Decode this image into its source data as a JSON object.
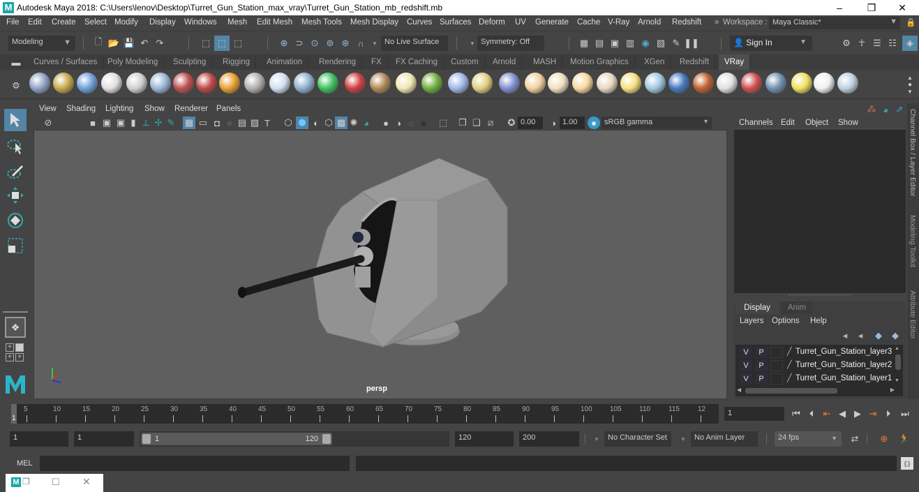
{
  "window": {
    "title": "Autodesk Maya 2018: C:\\Users\\lenov\\Desktop\\Turret_Gun_Station_max_vray\\Turret_Gun_Station_mb_redshift.mb",
    "minimize": "–",
    "restore": "❐",
    "close": "✕"
  },
  "menubar": {
    "items": [
      "File",
      "Edit",
      "Create",
      "Select",
      "Modify",
      "Display",
      "Windows",
      "Mesh",
      "Edit Mesh",
      "Mesh Tools",
      "Mesh Display",
      "Curves",
      "Surfaces",
      "Deform",
      "UV",
      "Generate",
      "Cache",
      "V-Ray",
      "Arnold",
      "Redshift"
    ],
    "workspace_label": "Workspace :",
    "workspace_value": "Maya Classic*"
  },
  "statusline": {
    "mode": "Modeling",
    "live_surface": "No Live Surface",
    "symmetry": "Symmetry: Off",
    "sign_in": "Sign In"
  },
  "shelf": {
    "tabs": [
      "Curves / Surfaces",
      "Poly Modeling",
      "Sculpting",
      "Rigging",
      "Animation",
      "Rendering",
      "FX",
      "FX Caching",
      "Custom",
      "Arnold",
      "MASH",
      "Motion Graphics",
      "XGen",
      "Redshift",
      "VRay"
    ],
    "active_tab": "VRay",
    "icons": [
      {
        "name": "vray-export-icon",
        "color": "#8fa3c8"
      },
      {
        "name": "vray-import-icon",
        "color": "#c8a84c"
      },
      {
        "name": "vray-settings-icon",
        "color": "#6fa0d8"
      },
      {
        "name": "vray-logo-icon",
        "color": "#e0e0e0"
      },
      {
        "name": "vray-framebuffer-icon",
        "color": "#d0d0d0"
      },
      {
        "name": "vray-material-icon",
        "color": "#9ab8d8"
      },
      {
        "name": "vray-proxy-icon",
        "color": "#c05050"
      },
      {
        "name": "vray-blend-icon",
        "color": "#c04848"
      },
      {
        "name": "vray-fire-icon",
        "color": "#e8a030"
      },
      {
        "name": "vray-plane-icon",
        "color": "#b0b0b0"
      },
      {
        "name": "vray-object-icon",
        "color": "#d0e0f0"
      },
      {
        "name": "vray-shapes-icon",
        "color": "#90b0d0"
      },
      {
        "name": "vray-light-icon",
        "color": "#40c060"
      },
      {
        "name": "vray-mesh-light-icon",
        "color": "#d04040"
      },
      {
        "name": "vray-texture-icon",
        "color": "#b08858"
      },
      {
        "name": "vray-sphere-light-icon",
        "color": "#f0e8b0"
      },
      {
        "name": "vray-fur-icon",
        "color": "#70b040"
      },
      {
        "name": "vray-particles-icon",
        "color": "#a0b8e8"
      },
      {
        "name": "vray-curves-icon",
        "color": "#e0d080"
      },
      {
        "name": "vray-dome-icon",
        "color": "#8090d0"
      },
      {
        "name": "vray-dome-light-icon",
        "color": "#f0d0a0"
      },
      {
        "name": "vray-ies-icon",
        "color": "#f0e0c0"
      },
      {
        "name": "vray-omni-icon",
        "color": "#f8d8a0"
      },
      {
        "name": "vray-spot-icon",
        "color": "#e8d8c0"
      },
      {
        "name": "vray-sun-icon",
        "color": "#f8e080"
      },
      {
        "name": "vray-sky-icon",
        "color": "#a0c8e0"
      },
      {
        "name": "vray-sphere-icon",
        "color": "#4878c0"
      },
      {
        "name": "vray-shader-ball-icon",
        "color": "#c06030"
      },
      {
        "name": "vray-checker-icon",
        "color": "#e0e0e0"
      },
      {
        "name": "vray-render-icon",
        "color": "#d05050"
      },
      {
        "name": "vray-vfb-icon",
        "color": "#7090b0"
      },
      {
        "name": "vray-light-lister-icon",
        "color": "#f0e060"
      },
      {
        "name": "vray-cloud-icon",
        "color": "#f0f0f0"
      },
      {
        "name": "help-icon",
        "color": "#c0d0e0"
      }
    ]
  },
  "viewport": {
    "menus": [
      "View",
      "Shading",
      "Lighting",
      "Show",
      "Renderer",
      "Panels"
    ],
    "exposure": "0.00",
    "gamma": "1.00",
    "color_space": "sRGB gamma",
    "camera_label": "persp"
  },
  "channel_box": {
    "menus": [
      "Channels",
      "Edit",
      "Object",
      "Show"
    ]
  },
  "layer_editor": {
    "tabs": [
      "Display",
      "Anim"
    ],
    "active_tab": "Display",
    "menus": [
      "Layers",
      "Options",
      "Help"
    ],
    "layers": [
      {
        "v": "V",
        "p": "P",
        "name": "Turret_Gun_Station_layer3"
      },
      {
        "v": "V",
        "p": "P",
        "name": "Turret_Gun_Station_layer2"
      },
      {
        "v": "V",
        "p": "P",
        "name": "Turret_Gun_Station_layer1"
      }
    ]
  },
  "side_tabs": [
    "Channel Box / Layer Editor",
    "Modeling Toolkit",
    "Attribute Editor"
  ],
  "timeline": {
    "ticks": [
      "5",
      "10",
      "15",
      "20",
      "25",
      "30",
      "35",
      "40",
      "45",
      "50",
      "55",
      "60",
      "65",
      "70",
      "75",
      "80",
      "85",
      "90",
      "95",
      "100",
      "105",
      "110",
      "115",
      "12"
    ],
    "current_frame_marker": "1",
    "current_frame": "1"
  },
  "range": {
    "start": "1",
    "playback_start": "1",
    "slider_start": "1",
    "slider_end": "120",
    "playback_end": "120",
    "end": "200",
    "character_set": "No Character Set",
    "anim_layer": "No Anim Layer",
    "fps": "24 fps"
  },
  "cmdline": {
    "label": "MEL"
  },
  "taskbar_popup": {
    "logo": "M"
  }
}
